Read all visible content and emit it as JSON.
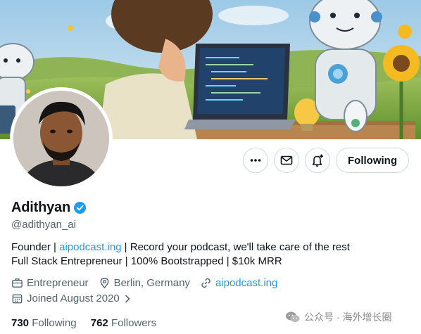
{
  "profile": {
    "display_name": "Adithyan",
    "handle": "@adithyan_ai",
    "bio_line1_prefix": "Founder | ",
    "bio_line1_link": "aipodcast.ing",
    "bio_line1_suffix": " | Record your podcast, we'll take care of the rest",
    "bio_line2": "Full Stack Entrepreneur | 100% Bootstrapped | $10k MRR",
    "category": "Entrepreneur",
    "location": "Berlin, Germany",
    "website": "aipodcast.ing",
    "joined": "Joined August 2020",
    "following_count": "730",
    "following_label": "Following",
    "followers_count": "762",
    "followers_label": "Followers"
  },
  "actions": {
    "follow_label": "Following",
    "more_icon": "more-dots-icon",
    "message_icon": "envelope-icon",
    "notify_icon": "bell-plus-icon"
  },
  "watermark": {
    "text": "公众号 · 海外增长圈"
  },
  "colors": {
    "accent": "#1d9bf0",
    "text_primary": "#0f1419",
    "text_secondary": "#536471",
    "border": "#cfd9de"
  }
}
